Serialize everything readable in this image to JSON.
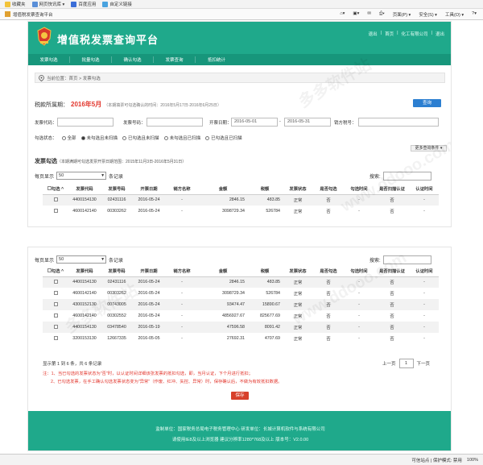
{
  "browser": {
    "favorites": "收藏夹",
    "fav_items": [
      "网页快讯库 ▾",
      "百度应用",
      "自定义链接"
    ],
    "tab_title": "增值税发票查询平台",
    "toolbar": [
      "页面(P) ▾",
      "安全(S) ▾",
      "工具(O) ▾"
    ]
  },
  "site": {
    "title": "增值税发票查询平台",
    "user_links": [
      "退出",
      "|",
      "首页",
      "|",
      "化工有限公司",
      "|",
      "退出"
    ]
  },
  "nav": [
    "发票勾选",
    "批量勾选",
    "确认勾选",
    "发票查询",
    "抵扣统计"
  ],
  "breadcrumb": "当前位置：首页 > 发票勾选",
  "period": {
    "label": "税款所属期：",
    "value": "2016年5月",
    "note": "（本期填票可勾选确认的时间：2016年5月17日-2016年6月25日）"
  },
  "query_button": "查询",
  "filters": {
    "invoice_code_label": "发票代码：",
    "invoice_number_label": "发票号码：",
    "date_label": "开票日期：",
    "date_from": "2016-05-01",
    "date_to": "2016-05-31",
    "date_sep": "-",
    "seller_tax_label": "销方税号：",
    "status_label": "勾选状态：",
    "status_options": [
      "全部",
      "未勾选且未扫描",
      "已勾选且未扫描",
      "未勾选且已扫描",
      "已勾选且已扫描"
    ],
    "more_button": "更多查询条件 ▾"
  },
  "section": {
    "title": "发票勾选",
    "note": "（本期满期可勾选发票开票日期范围：2015年11月3日-2016年5月31日）"
  },
  "list": {
    "per_page_label": "每页显示",
    "per_page_value": "50",
    "per_page_suffix": "条记录",
    "search_label": "搜索:",
    "headers": [
      "勾选 ^",
      "发票代码",
      "发票号码",
      "开票日期",
      "销方名称",
      "金额",
      "税额",
      "发票状态",
      "是否勾选",
      "勾选时间",
      "是否扫描认证",
      "认证时间"
    ],
    "rows": [
      [
        "4400154130",
        "02431116",
        "2016-05-24",
        "-",
        "2846.15",
        "483.85",
        "正常",
        "否",
        "-",
        "否",
        "-"
      ],
      [
        "4600142140",
        "00303262",
        "2016-05-24",
        "-",
        "3098729.34",
        "526784",
        "正常",
        "否",
        "-",
        "否",
        "-"
      ],
      [
        "4300152130",
        "00743005",
        "2016-05-24",
        "-",
        "93474.47",
        "15890.67",
        "正常",
        "否",
        "-",
        "否",
        "-"
      ],
      [
        "4600142140",
        "00302552",
        "2016-05-24",
        "-",
        "4856927.67",
        "825677.69",
        "正常",
        "否",
        "-",
        "否",
        "-"
      ],
      [
        "4400154130",
        "03478540",
        "2016-05-19",
        "-",
        "47596.58",
        "8091.42",
        "正常",
        "否",
        "-",
        "否",
        "-"
      ],
      [
        "3200153130",
        "12667335",
        "2016-05-05",
        "-",
        "27692.31",
        "4707.69",
        "正常",
        "否",
        "-",
        "否",
        "-"
      ]
    ],
    "summary": "显示第 1 到 6 条，共 6 条记录",
    "prev": "上一页",
    "page": "1",
    "next": "下一页"
  },
  "notes": [
    "注：1、当已勾选的发票状态为\"否\"时，以认证时间详细该张发票的抵扣勾选，即，当月认证，下个月进行抵扣；",
    "2、已勾选发票，在手工确认勾选发票状态变为\"异常\"（作废、红冲、失控、异常）时，保存确认后，不做为有效抵扣数据。"
  ],
  "save_button": "保存",
  "footer": {
    "line1": "监制单位：国家税务总局电子税务管理中心    研发单位：长城计算机软件与系统有限公司",
    "line2": "请使用IE8及以上浏览器    建议分辨率1280*768及以上    版本号：V2.0.00"
  },
  "status_bar": [
    "可信站点 | 保护模式: 禁用",
    "100%"
  ],
  "colors": {
    "brand": "#1fa98b",
    "nav": "#17967b",
    "accent_red": "#e2352c",
    "query_blue": "#2c7fd1"
  }
}
